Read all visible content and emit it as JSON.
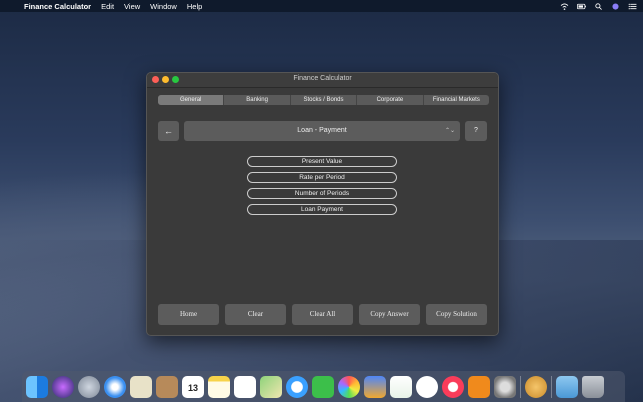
{
  "menubar": {
    "app_name": "Finance Calculator",
    "menus": [
      "Edit",
      "View",
      "Window",
      "Help"
    ]
  },
  "window": {
    "title": "Finance Calculator",
    "tabs": [
      "General",
      "Banking",
      "Stocks / Bonds",
      "Corporate",
      "Financial Markets"
    ],
    "active_tab": "General",
    "back_label": "←",
    "calculation_select": "Loan - Payment",
    "help_label": "?",
    "fields": [
      "Present Value",
      "Rate per Period",
      "Number of Periods",
      "Loan Payment"
    ],
    "buttons": {
      "home": "Home",
      "clear": "Clear",
      "clear_all": "Clear All",
      "copy_answer": "Copy Answer",
      "copy_solution": "Copy Solution"
    }
  },
  "dock": {
    "icons": [
      "finder-icon",
      "siri-icon",
      "launchpad-icon",
      "safari-icon",
      "photo-preview-icon",
      "contacts-icon",
      "calendar-icon",
      "notes-icon",
      "reminders-icon",
      "maps-icon",
      "messages-icon",
      "facetime-icon",
      "photos-icon",
      "keynote-icon",
      "numbers-icon",
      "news-icon",
      "music-icon",
      "books-icon",
      "system-preferences-icon",
      "finance-calculator-icon",
      "downloads-folder-icon",
      "trash-icon"
    ],
    "calendar_day": "13"
  }
}
